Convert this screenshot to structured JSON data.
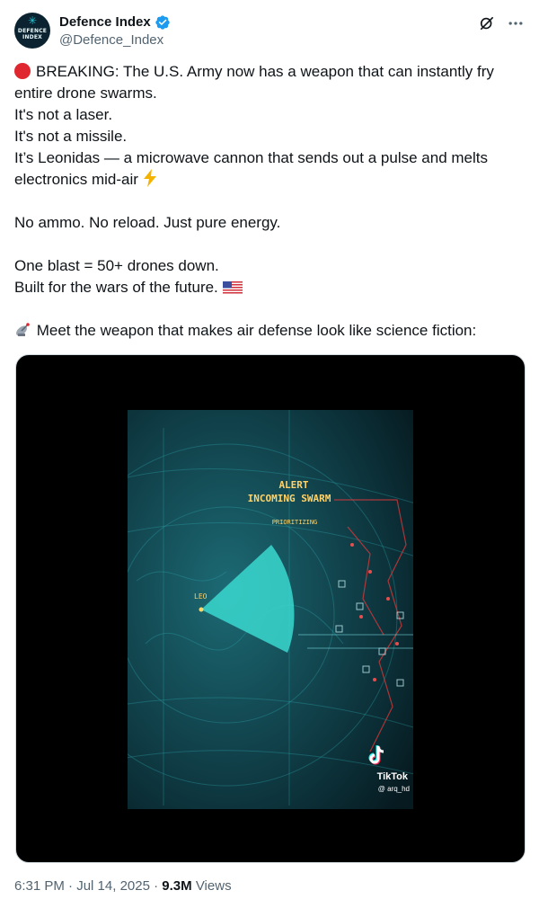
{
  "account": {
    "display_name": "Defence Index",
    "handle": "@Defence_Index",
    "avatar_line1": "DEFENCE",
    "avatar_line2": "INDEX",
    "verified_color": "#1d9bf0"
  },
  "icons": {
    "grok": "grok-icon",
    "more": "more-icon"
  },
  "tweet": {
    "p1": "BREAKING: The U.S. Army now has a weapon that can instantly fry entire drone swarms.",
    "p2": "It's not a laser.",
    "p3": "It's not a missile.",
    "p4": "It’s Leonidas — a microwave cannon that sends out a pulse and melts electronics mid-air",
    "p5": "No ammo. No reload. Just pure energy.",
    "p6": "One blast = 50+ drones down.",
    "p7": "Built for the wars of the future.",
    "p8": "Meet the weapon that makes air defense look like science fiction:"
  },
  "video": {
    "alert_line1": "ALERT",
    "alert_line2": "INCOMING SWARM",
    "alert_line3": "PRIORITIZING",
    "origin_label": "LEO",
    "watermark_brand": "TikTok",
    "watermark_user": "@ arq_hd"
  },
  "meta": {
    "time": "6:31 PM",
    "sep1": " · ",
    "date": "Jul 14, 2025",
    "sep2": " · ",
    "views_count": "9.3M",
    "views_label": " Views"
  }
}
